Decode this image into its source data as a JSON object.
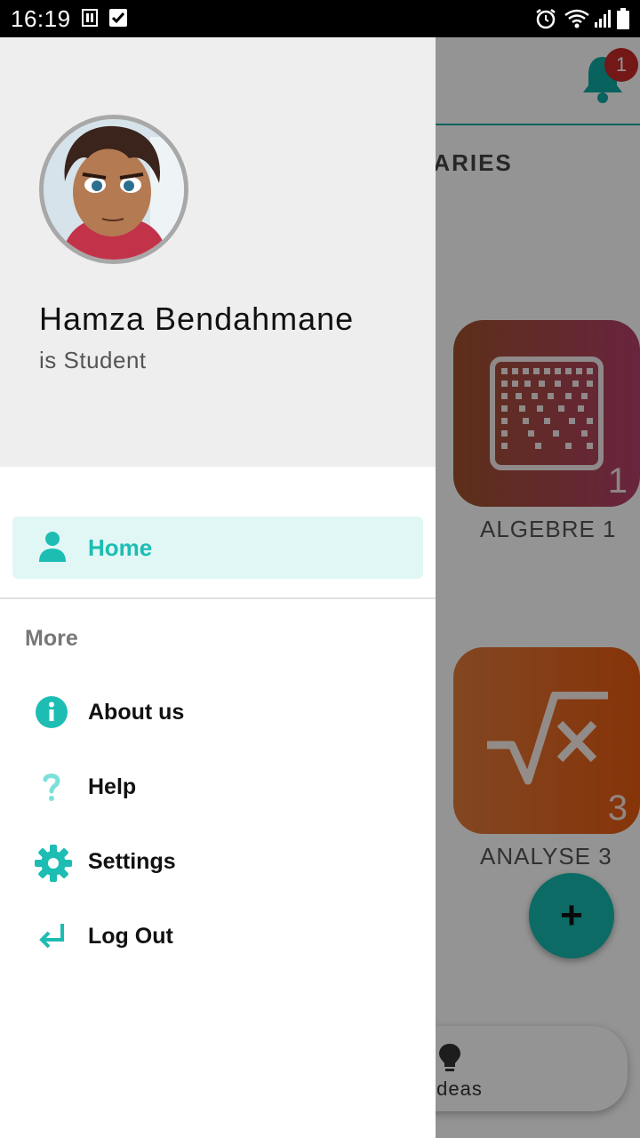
{
  "status_bar": {
    "time": "16:19"
  },
  "notification": {
    "count": "1"
  },
  "tabs": {
    "visible_label": "MMARIES"
  },
  "cards": [
    {
      "label": "ALGEBRE 1",
      "number": "1"
    },
    {
      "label": "ANALYSE 3",
      "number": "3"
    }
  ],
  "fab": {
    "symbol": "+"
  },
  "bottom_nav": {
    "ideas_label": "Ideas"
  },
  "drawer": {
    "user": {
      "name": "Hamza Bendahmane",
      "role": "is Student"
    },
    "home_label": "Home",
    "section_more": "More",
    "items": [
      {
        "label": "About us",
        "icon": "info-icon"
      },
      {
        "label": "Help",
        "icon": "help-icon"
      },
      {
        "label": "Settings",
        "icon": "gear-icon"
      },
      {
        "label": "Log Out",
        "icon": "logout-icon"
      }
    ]
  },
  "colors": {
    "accent": "#1dbdb3",
    "badge": "#c62828",
    "header_bg": "#eeeeee"
  }
}
